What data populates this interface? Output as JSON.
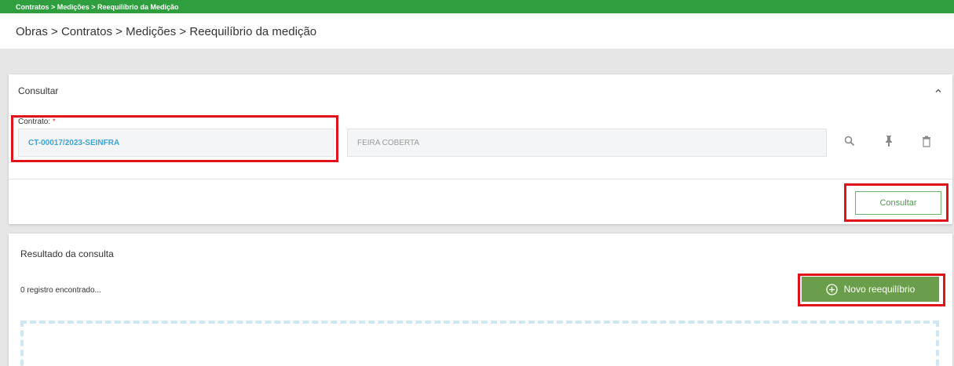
{
  "breadcrumb_top": "Contratos > Medições > Reequilíbrio da Medição",
  "page_title": "Obras > Contratos > Medições > Reequilíbrio da medição",
  "consultar_card": {
    "title": "Consultar",
    "contrato_label": "Contrato:",
    "required_mark": "*",
    "contrato_value": "CT-00017/2023-SEINFRA",
    "descricao_value": "FEIRA COBERTA",
    "consultar_button": "Consultar"
  },
  "resultado_card": {
    "title": "Resultado da consulta",
    "count_text": "0 registro encontrado...",
    "novo_button": "Novo reequilíbrio"
  },
  "colors": {
    "header_green": "#2e9e3e",
    "primary_button": "#6a9e4a",
    "link_blue": "#3ba3d6",
    "highlight_red": "#e0131b"
  },
  "icons": [
    "chevron-up-icon",
    "search-icon",
    "pin-icon",
    "trash-icon",
    "plus-circle-icon"
  ]
}
